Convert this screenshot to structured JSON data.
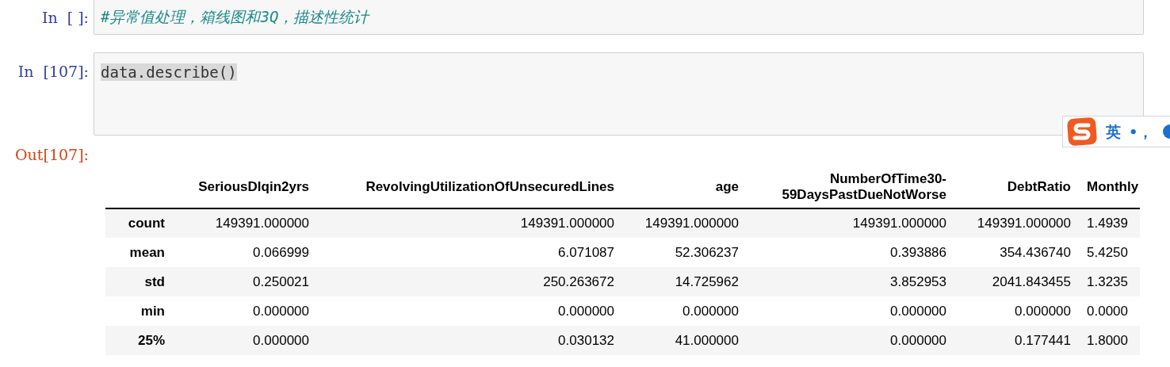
{
  "cells": [
    {
      "kind": "markdown_raw",
      "prompt": "In  [ ]:",
      "source": "#异常值处理，箱线图和3Q，描述性统计",
      "selected": false
    },
    {
      "kind": "code",
      "prompt": "In  [107]:",
      "source": "data.describe()",
      "selected": true
    }
  ],
  "output": {
    "prompt": "Out[107]:",
    "table": {
      "columns": [
        "SeriousDlqin2yrs",
        "RevolvingUtilizationOfUnsecuredLines",
        "age",
        "NumberOfTime30-\n59DaysPastDueNotWorse",
        "DebtRatio",
        "Monthly"
      ],
      "rows": [
        {
          "index": "count",
          "cells": [
            "149391.000000",
            "149391.000000",
            "149391.000000",
            "149391.000000",
            "149391.000000",
            "1.4939"
          ]
        },
        {
          "index": "mean",
          "cells": [
            "0.066999",
            "6.071087",
            "52.306237",
            "0.393886",
            "354.436740",
            "5.4250"
          ]
        },
        {
          "index": "std",
          "cells": [
            "0.250021",
            "250.263672",
            "14.725962",
            "3.852953",
            "2041.843455",
            "1.3235"
          ]
        },
        {
          "index": "min",
          "cells": [
            "0.000000",
            "0.000000",
            "0.000000",
            "0.000000",
            "0.000000",
            "0.0000"
          ]
        },
        {
          "index": "25%",
          "cells": [
            "0.000000",
            "0.030132",
            "41.000000",
            "0.000000",
            "0.177441",
            "1.8000"
          ]
        }
      ]
    }
  },
  "ime_toolbar": {
    "mode": "英",
    "punctuation": "•，"
  }
}
